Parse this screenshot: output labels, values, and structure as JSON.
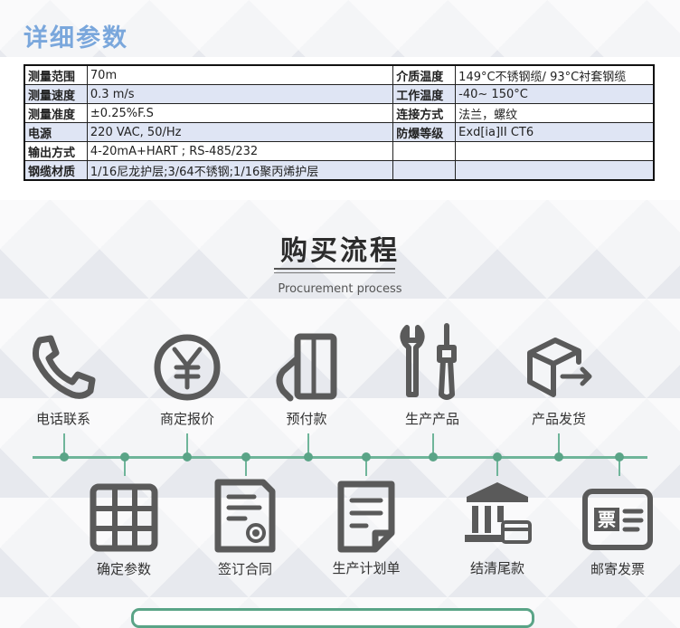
{
  "section_title": "详细参数",
  "specs": [
    {
      "k1": "测量范围",
      "v1": "70m",
      "k2": "介质温度",
      "v2": "149°C不锈钢缆/ 93°C衬套钢缆"
    },
    {
      "k1": "测量速度",
      "v1": "0.3 m/s",
      "k2": "工作温度",
      "v2": "-40~ 150°C"
    },
    {
      "k1": "测量准度",
      "v1": "±0.25%F.S",
      "k2": "连接方式",
      "v2": "法兰，螺纹"
    },
    {
      "k1": "电源",
      "v1": "220 VAC, 50/Hz",
      "k2": "防爆等级",
      "v2": "Exd[ia]II CT6"
    },
    {
      "k1": "输出方式",
      "v1": "4-20mA+HART ; RS-485/232",
      "k2": "",
      "v2": ""
    },
    {
      "k1": "钢缆材质",
      "v1": "1/16尼龙护层;3/64不锈钢;1/16聚丙烯护层",
      "k2": "",
      "v2": ""
    }
  ],
  "process": {
    "title": "购买流程",
    "subtitle": "Procurement process",
    "top_steps": [
      {
        "label": "电话联系",
        "icon": "phone-icon"
      },
      {
        "label": "商定报价",
        "icon": "yen-icon"
      },
      {
        "label": "预付款",
        "icon": "payment-card-icon"
      },
      {
        "label": "生产产品",
        "icon": "tools-icon"
      },
      {
        "label": "产品发货",
        "icon": "shipping-box-icon"
      }
    ],
    "bottom_steps": [
      {
        "label": "确定参数",
        "icon": "grid-icon"
      },
      {
        "label": "签订合同",
        "icon": "contract-icon"
      },
      {
        "label": "生产计划单",
        "icon": "document-icon"
      },
      {
        "label": "结清尾款",
        "icon": "bank-icon"
      },
      {
        "label": "邮寄发票",
        "icon": "invoice-icon"
      }
    ],
    "invoice_glyph": "票"
  },
  "colors": {
    "title_blue": "#7aa7dc",
    "timeline_green": "#6fb59a",
    "row_alt": "#dfe5f4",
    "icon_gray": "#5a5a5a"
  }
}
